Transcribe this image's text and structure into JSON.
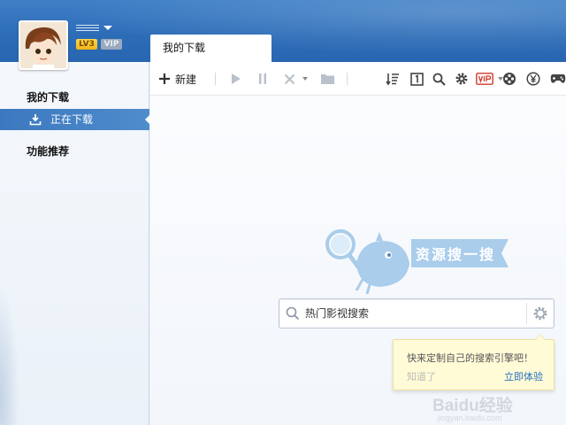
{
  "user": {
    "level_badge": "LV3",
    "vip_badge": "VIP"
  },
  "tabs": [
    {
      "label": "我的下载",
      "active": true
    }
  ],
  "sidebar": {
    "section_my_downloads": "我的下载",
    "active_item": "正在下载",
    "section_recommend": "功能推荐"
  },
  "toolbar": {
    "new_label": "新建",
    "icons": [
      "plus-icon",
      "play-icon",
      "pause-icon",
      "delete-icon",
      "folder-icon",
      "sort-icon",
      "file-icon",
      "search-icon",
      "gear-icon",
      "vip-icon",
      "film-icon",
      "yen-icon",
      "game-icon"
    ]
  },
  "search": {
    "placeholder": "热门影视搜索"
  },
  "brand_banner": {
    "text": "资源搜一搜"
  },
  "tip": {
    "message": "快来定制自己的搜索引擎吧！",
    "dismiss": "知道了",
    "action": "立即体验"
  },
  "watermark": {
    "brand": "Baidu经验",
    "url": "jingyan.baidu.com"
  },
  "colors": {
    "header": "#2c6cb7",
    "sidebar_active": "#3b78bf",
    "link": "#2a6fc1",
    "tip_bg": "#fffbd6"
  }
}
